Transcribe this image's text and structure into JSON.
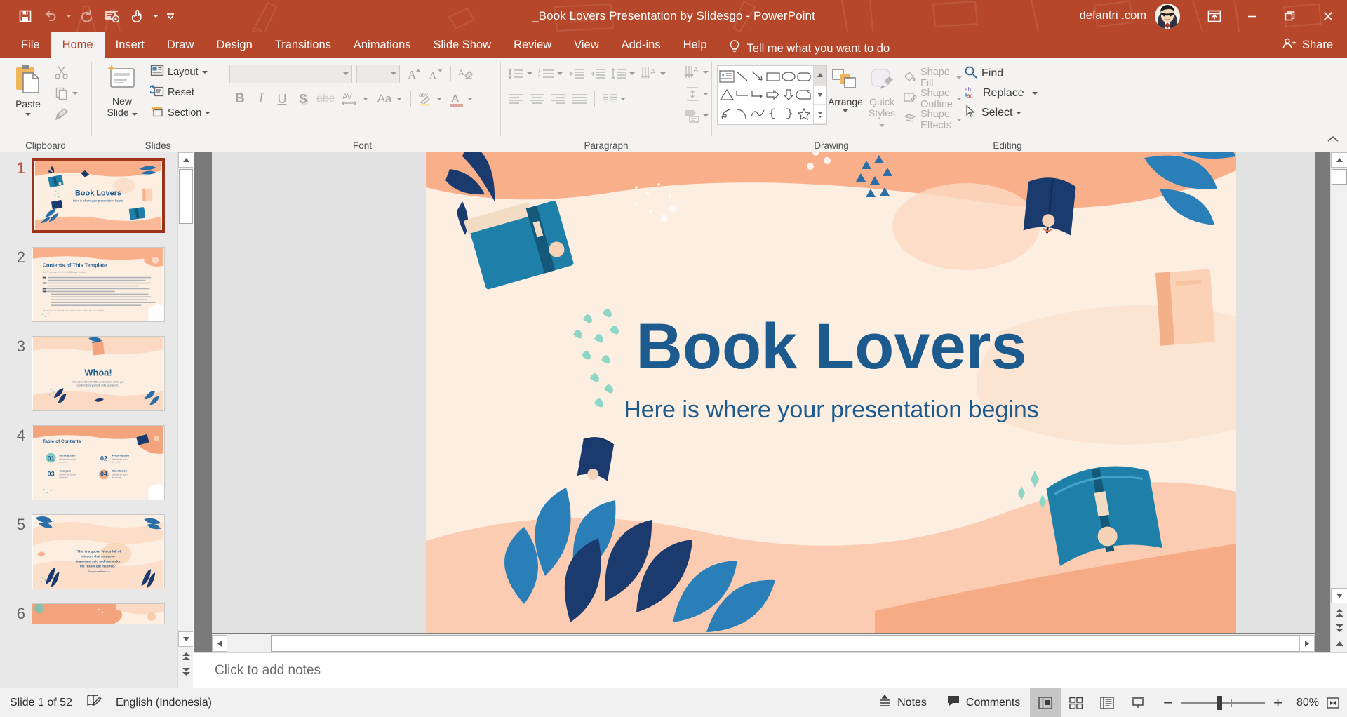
{
  "app": {
    "title": "_Book Lovers Presentation by Slidesgo  -  PowerPoint",
    "account_name": "defantri .com",
    "accent_color": "#b7472a",
    "slide_bg": "#fdeee2",
    "slide_ink": "#1d5b8e"
  },
  "quick_access": {
    "items": [
      {
        "name": "save-icon",
        "label": "Save"
      },
      {
        "name": "undo-icon",
        "label": "Undo"
      },
      {
        "name": "redo-icon",
        "label": "Redo"
      },
      {
        "name": "start-presentation-icon",
        "label": "Start From Beginning"
      },
      {
        "name": "touch-mode-icon",
        "label": "Touch/Mouse Mode"
      },
      {
        "name": "customize-quick-access-icon",
        "label": "Customize Quick Access Toolbar"
      }
    ]
  },
  "window_controls": {
    "ribbon_display_options": "Ribbon Display Options",
    "minimize": "Minimize",
    "restore": "Restore Down",
    "close": "Close"
  },
  "tabs": [
    {
      "label": "File",
      "active": false
    },
    {
      "label": "Home",
      "active": true
    },
    {
      "label": "Insert",
      "active": false
    },
    {
      "label": "Draw",
      "active": false
    },
    {
      "label": "Design",
      "active": false
    },
    {
      "label": "Transitions",
      "active": false
    },
    {
      "label": "Animations",
      "active": false
    },
    {
      "label": "Slide Show",
      "active": false
    },
    {
      "label": "Review",
      "active": false
    },
    {
      "label": "View",
      "active": false
    },
    {
      "label": "Add-ins",
      "active": false
    },
    {
      "label": "Help",
      "active": false
    }
  ],
  "tell_me": "Tell me what you want to do",
  "share_label": "Share",
  "ribbon": {
    "groups": {
      "clipboard": {
        "name": "Clipboard",
        "paste": "Paste",
        "cut": "Cut",
        "copy": "Copy",
        "format_painter": "Format Painter"
      },
      "slides": {
        "name": "Slides",
        "new_slide_line1": "New",
        "new_slide_line2": "Slide",
        "layout": "Layout",
        "reset": "Reset",
        "section": "Section"
      },
      "font": {
        "name": "Font",
        "font_name_value": "",
        "font_size_value": "",
        "increase_font": "Increase Font Size",
        "decrease_font": "Decrease Font Size",
        "clear_formatting": "Clear All Formatting",
        "bold": "B",
        "italic": "I",
        "underline": "U",
        "shadow": "S",
        "strikethrough": "abc",
        "character_spacing": "AV",
        "change_case": "Aa",
        "highlight": "Text Highlight Color",
        "font_color": "A"
      },
      "paragraph": {
        "name": "Paragraph",
        "bullets": "Bullets",
        "numbering": "Numbering",
        "decrease_indent": "Decrease List Level",
        "increase_indent": "Increase List Level",
        "line_spacing": "Line Spacing",
        "text_direction": "Text Direction",
        "align_text": "Align Text",
        "convert_to_smartart": "Convert to SmartArt",
        "align_left": "Align Left",
        "center": "Center",
        "align_right": "Align Right",
        "justify": "Justify",
        "columns": "Columns"
      },
      "drawing": {
        "name": "Drawing",
        "arrange": "Arrange",
        "quick_styles_line1": "Quick",
        "quick_styles_line2": "Styles",
        "shape_fill": "Shape Fill",
        "shape_outline": "Shape Outline",
        "shape_effects": "Shape Effects",
        "shapes": [
          "text-box-shape",
          "line-shape",
          "arrow-shape",
          "rectangle-shape",
          "oval-shape",
          "rounded-rectangle-shape",
          "triangle-shape",
          "elbow-connector-shape",
          "elbow-arrow-connector-shape",
          "right-arrow-shape",
          "down-arrow-shape",
          "folded-corner-shape",
          "scribble-shape",
          "arc-shape",
          "curve-shape",
          "left-brace-shape",
          "right-brace-shape",
          "star-shape"
        ]
      },
      "editing": {
        "name": "Editing",
        "find": "Find",
        "replace": "Replace",
        "select": "Select"
      }
    },
    "collapse_ribbon": "Collapse the Ribbon"
  },
  "thumbnails": [
    {
      "number": "1",
      "selected": true,
      "kind": "title",
      "title": "Book Lovers",
      "subtitle": "Here is where your presentation begins"
    },
    {
      "number": "2",
      "selected": false,
      "kind": "contents",
      "title": "Contents of This Template",
      "subtitle": ""
    },
    {
      "number": "3",
      "selected": false,
      "kind": "whoa",
      "title": "Whoa!",
      "subtitle": "It could be the part of the presentation where you can introduce yourself, write your email..."
    },
    {
      "number": "4",
      "selected": false,
      "kind": "toc",
      "title": "Table of Contents",
      "subtitle": ""
    },
    {
      "number": "5",
      "selected": false,
      "kind": "quote",
      "title": "\"This is a quote. Words full of wisdom that someone important said and can make the reader get inspired.\"",
      "subtitle": "- Someone Famous"
    },
    {
      "number": "6",
      "selected": false,
      "kind": "partial",
      "title": "",
      "subtitle": ""
    }
  ],
  "toc_entries": [
    {
      "num": "01",
      "heading": "Introduction",
      "desc": "Describe the topic of the section"
    },
    {
      "num": "02",
      "heading": "Presentation",
      "desc": "Describe the topic of the section"
    },
    {
      "num": "03",
      "heading": "Analysis",
      "desc": "Describe the topic of the section"
    },
    {
      "num": "04",
      "heading": "Conclusion",
      "desc": "Describe the topic of the section"
    }
  ],
  "slide": {
    "title": "Book Lovers",
    "subtitle": "Here is where your presentation begins"
  },
  "notes": {
    "placeholder": "Click to add notes"
  },
  "status_bar": {
    "slide_counter": "Slide 1 of 52",
    "spellcheck_icon": "proofing-icon",
    "language": "English (Indonesia)",
    "notes_label": "Notes",
    "comments_label": "Comments",
    "views": [
      {
        "name": "normal-view-button",
        "label": "Normal",
        "active": true
      },
      {
        "name": "slide-sorter-view-button",
        "label": "Slide Sorter",
        "active": false
      },
      {
        "name": "reading-view-button",
        "label": "Reading View",
        "active": false
      },
      {
        "name": "slide-show-button",
        "label": "Slide Show",
        "active": false
      }
    ],
    "zoom_out": "−",
    "zoom_in": "+",
    "zoom_value": "80%",
    "fit_to_window": "Fit slide to current window"
  }
}
